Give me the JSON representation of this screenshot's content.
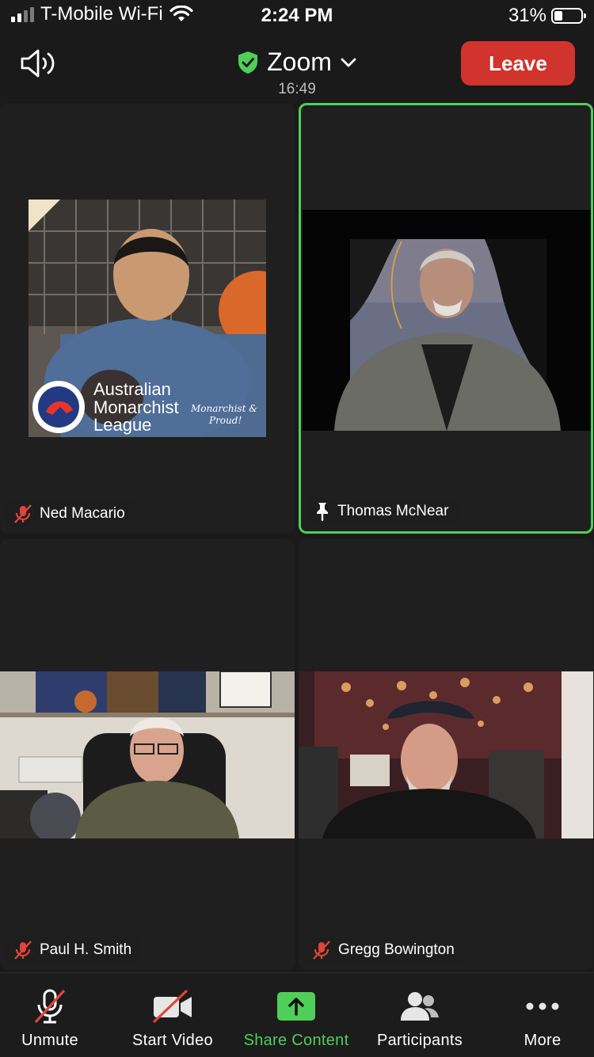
{
  "status_bar": {
    "carrier": "T-Mobile Wi-Fi",
    "time": "2:24 PM",
    "battery": "31%"
  },
  "header": {
    "app_title": "Zoom",
    "timer": "16:49",
    "leave_label": "Leave"
  },
  "participants": [
    {
      "name": "Ned Macario",
      "muted": true,
      "badge_line1": "Australian",
      "badge_line2": "Monarchist",
      "badge_line3": "League",
      "badge_script1": "Monarchist &",
      "badge_script2": "Proud!"
    },
    {
      "name": "Thomas McNear",
      "pinned": true,
      "active_speaker": true
    },
    {
      "name": "Paul H. Smith",
      "muted": true
    },
    {
      "name": "Gregg Bowington",
      "muted": true
    }
  ],
  "toolbar": {
    "unmute_label": "Unmute",
    "start_video_label": "Start Video",
    "share_label": "Share Content",
    "participants_label": "Participants",
    "more_label": "More"
  },
  "colors": {
    "leave": "#d0342c",
    "active_border": "#4fcf5a",
    "share": "#4fcf5a",
    "muted_red": "#e0453a"
  }
}
